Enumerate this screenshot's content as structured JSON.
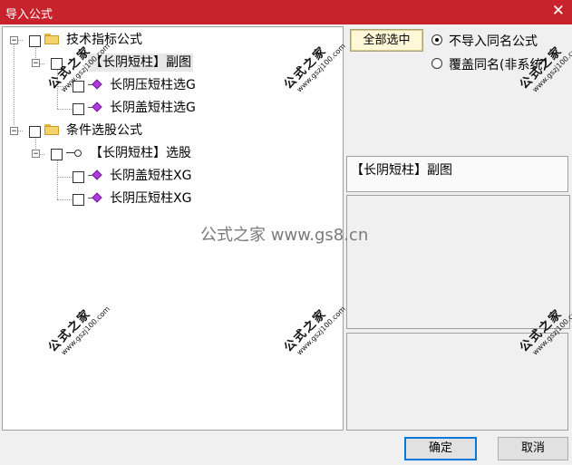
{
  "window": {
    "title": "导入公式",
    "close_glyph": "✕"
  },
  "tree": {
    "groups": [
      {
        "expander": "−",
        "label": "技术指标公式",
        "children": [
          {
            "expander": "−",
            "label": "【长阴短柱】副图",
            "selected": true,
            "children": [
              {
                "label": "长阴压短柱选G",
                "icon": "formula-gem-icon"
              },
              {
                "label": "长阴盖短柱选G",
                "icon": "formula-gem-icon"
              }
            ]
          }
        ]
      },
      {
        "expander": "−",
        "label": "条件选股公式",
        "children": [
          {
            "expander": "−",
            "label": "【长阴短柱】选股",
            "icon": "key-icon",
            "children": [
              {
                "label": "长阴盖短柱XG",
                "icon": "formula-gem-icon"
              },
              {
                "label": "长阴压短柱XG",
                "icon": "formula-gem-icon"
              }
            ]
          }
        ]
      }
    ]
  },
  "right": {
    "select_all_label": "全部选中",
    "options": [
      {
        "label": "不导入同名公式",
        "checked": true
      },
      {
        "label": "覆盖同名(非系统)",
        "checked": false
      }
    ],
    "description": "【长阴短柱】副图"
  },
  "footer": {
    "ok_label": "确定",
    "cancel_label": "取消"
  },
  "watermark": {
    "brand": "公式之家",
    "url": "www.gszj100.com",
    "center_text": "公式之家 www.gs8.cn"
  },
  "colors": {
    "titlebar": "#c8232d",
    "folder": "#f5d36b",
    "gem": "#b23be0"
  }
}
